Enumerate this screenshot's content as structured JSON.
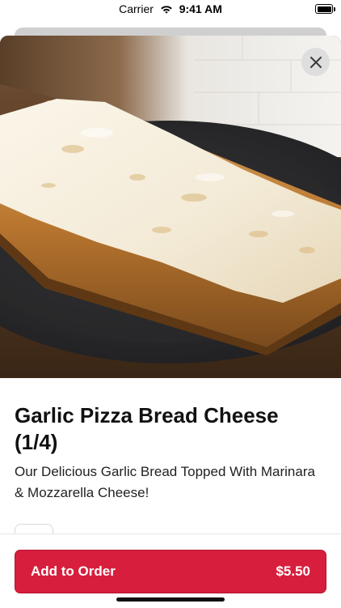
{
  "status_bar": {
    "carrier": "Carrier",
    "time": "9:41 AM",
    "wifi_icon": "wifi-icon",
    "battery_icon": "battery-icon",
    "battery_level": 1.0
  },
  "item": {
    "image_alt_icon": "food-photo",
    "title": "Garlic Pizza Bread Cheese (1/4)",
    "description": "Our Delicious Garlic Bread Topped With Marinara & Mozzarella Cheese!"
  },
  "actions": {
    "close_icon": "close-icon",
    "add_label": "Add to Order",
    "price": "$5.50"
  },
  "colors": {
    "accent": "#d71f3d",
    "text": "#111111"
  }
}
